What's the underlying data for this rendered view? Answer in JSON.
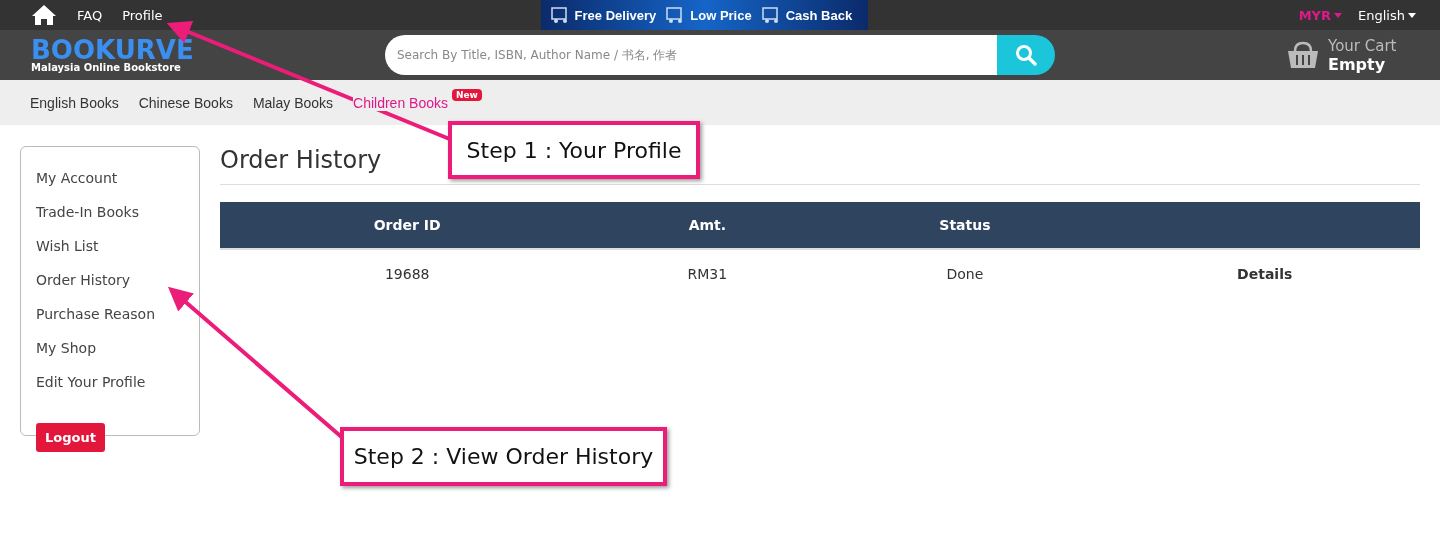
{
  "top_bar": {
    "links": [
      "FAQ",
      "Profile"
    ],
    "promo": [
      "Free Delivery",
      "Low Price",
      "Cash Back"
    ],
    "currency": "MYR",
    "language": "English"
  },
  "header": {
    "logo": "BOOKURVE",
    "tagline": "Malaysia Online Bookstore",
    "search": {
      "placeholder": "Search By Title, ISBN, Author Name / 书名, 作者"
    },
    "cart": {
      "label": "Your Cart",
      "status": "Empty"
    }
  },
  "categories": [
    {
      "label": "English Books",
      "highlight": false
    },
    {
      "label": "Chinese Books",
      "highlight": false
    },
    {
      "label": "Malay Books",
      "highlight": false
    },
    {
      "label": "Children Books",
      "highlight": true,
      "badge": "New"
    }
  ],
  "sidebar": {
    "items": [
      "My Account",
      "Trade-In Books",
      "Wish List",
      "Order History",
      "Purchase Reason",
      "My Shop",
      "Edit Your Profile"
    ],
    "logout": "Logout"
  },
  "page_title": "Order History",
  "table": {
    "columns": [
      "Order ID",
      "Amt.",
      "Status",
      ""
    ],
    "rows": [
      [
        "19688",
        "RM31",
        "Done",
        "Details"
      ]
    ]
  },
  "annotations": [
    "Step 1 : Your Profile",
    "Step 2 : View Order History"
  ]
}
